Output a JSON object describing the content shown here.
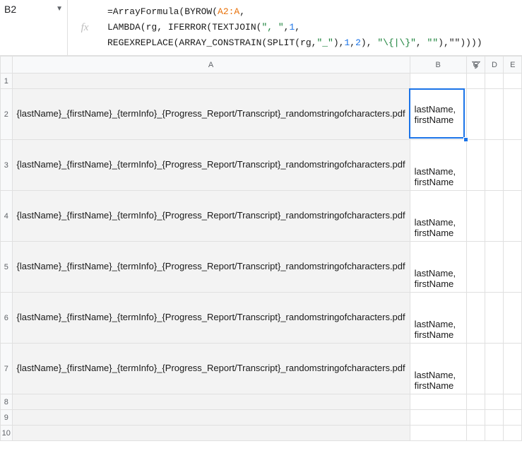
{
  "formulaBar": {
    "cellRef": "B2",
    "fx": "fx",
    "line1_pre": "=ArrayFormula(BYROW(",
    "line1_range": "A2:A",
    "line1_post": ",",
    "line2_pre": "LAMBDA(rg, IFERROR(TEXTJOIN(",
    "line2_str1": "\", \"",
    "line2_mid": ",",
    "line2_num1": "1",
    "line2_post": ",",
    "line3_pre": "REGEXREPLACE(ARRAY_CONSTRAIN(SPLIT(rg,",
    "line3_str1": "\"_\"",
    "line3_mid1": "),",
    "line3_num1": "1",
    "line3_mid2": ",",
    "line3_num2": "2",
    "line3_mid3": "), ",
    "line3_str2": "\"\\{|\\}\"",
    "line3_mid4": ", ",
    "line3_str3": "\"\"",
    "line3_post": "),\"\"))))"
  },
  "columns": [
    "A",
    "B",
    "C",
    "D",
    "E"
  ],
  "rowNumbers": [
    "1",
    "2",
    "3",
    "4",
    "5",
    "6",
    "7",
    "8",
    "9",
    "10"
  ],
  "rows": [
    {
      "a": "",
      "b": ""
    },
    {
      "a": "{lastName}_{firstName}_{termInfo}_{Progress_Report/Transcript}_randomstringofcharacters.pdf",
      "b": "lastName, firstName"
    },
    {
      "a": "{lastName}_{firstName}_{termInfo}_{Progress_Report/Transcript}_randomstringofcharacters.pdf",
      "b": "lastName, firstName"
    },
    {
      "a": "{lastName}_{firstName}_{termInfo}_{Progress_Report/Transcript}_randomstringofcharacters.pdf",
      "b": "lastName, firstName"
    },
    {
      "a": "{lastName}_{firstName}_{termInfo}_{Progress_Report/Transcript}_randomstringofcharacters.pdf",
      "b": "lastName, firstName"
    },
    {
      "a": "{lastName}_{firstName}_{termInfo}_{Progress_Report/Transcript}_randomstringofcharacters.pdf",
      "b": "lastName, firstName"
    },
    {
      "a": "{lastName}_{firstName}_{termInfo}_{Progress_Report/Transcript}_randomstringofcharacters.pdf",
      "b": "lastName, firstName"
    },
    {
      "a": "",
      "b": ""
    },
    {
      "a": "",
      "b": ""
    },
    {
      "a": "",
      "b": ""
    }
  ],
  "activeCell": {
    "row": 2,
    "col": "B"
  }
}
